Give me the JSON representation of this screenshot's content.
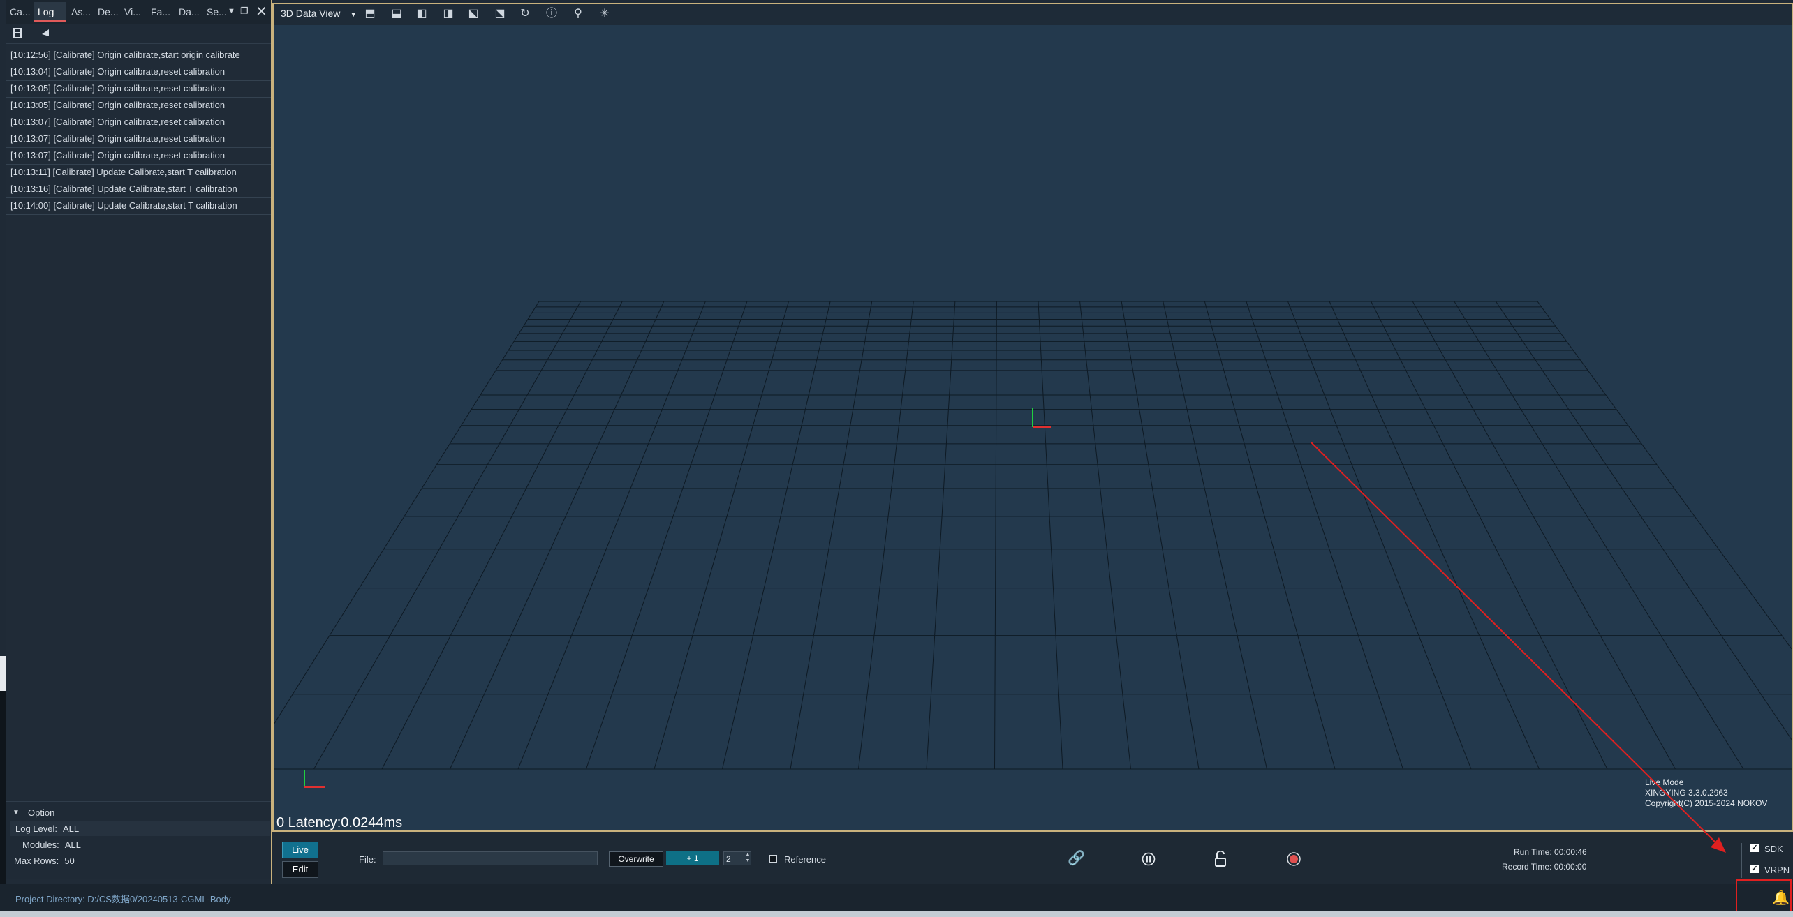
{
  "left_panel": {
    "tabs": [
      {
        "label": "Ca..."
      },
      {
        "label": "Log",
        "active": true
      },
      {
        "label": "As..."
      },
      {
        "label": "De..."
      },
      {
        "label": "Vi..."
      },
      {
        "label": "Fa..."
      },
      {
        "label": "Da..."
      },
      {
        "label": "Se..."
      }
    ],
    "log_entries": [
      "[10:12:56] [Calibrate] Origin calibrate,start origin calibrate",
      "[10:13:04] [Calibrate] Origin calibrate,reset calibration",
      "[10:13:05] [Calibrate] Origin calibrate,reset calibration",
      "[10:13:05] [Calibrate] Origin calibrate,reset calibration",
      "[10:13:07] [Calibrate] Origin calibrate,reset calibration",
      "[10:13:07] [Calibrate] Origin calibrate,reset calibration",
      "[10:13:07] [Calibrate] Origin calibrate,reset calibration",
      "[10:13:11] [Calibrate] Update Calibrate,start T calibration",
      "[10:13:16] [Calibrate] Update Calibrate,start T calibration",
      "[10:14:00] [Calibrate] Update Calibrate,start T calibration"
    ],
    "option": {
      "title": "Option",
      "log_level_label": "Log Level:",
      "log_level_value": "ALL",
      "modules_label": "Modules:",
      "modules_value": "ALL",
      "max_rows_label": "Max Rows:",
      "max_rows_value": "50"
    }
  },
  "status_bar": {
    "project_directory": "Project Directory:  D:/CS数据0/20240513-CGML-Body"
  },
  "view": {
    "title": "3D Data View",
    "latency": "0 Latency:0.0244ms",
    "mode": "Live Mode",
    "version": "XINGYING 3.3.0.2963",
    "copyright": "Copyright(C) 2015-2024 NOKOV",
    "colors": {
      "grid": "#0e1a24",
      "background": "#23394d",
      "axis_x": "#e03030",
      "axis_y": "#20d040"
    }
  },
  "controls": {
    "live_label": "Live",
    "edit_label": "Edit",
    "file_label": "File:",
    "file_value": "",
    "overwrite_label": "Overwrite",
    "increment_label": "+ 1",
    "step_value": "2",
    "reference_label": "Reference",
    "run_time": "Run Time:  00:00:46",
    "record_time": "Record Time:  00:00:00",
    "sdk_label": "SDK",
    "vrpn_label": "VRPN",
    "sdk_checked": true,
    "vrpn_checked": true
  },
  "annotation": {
    "color": "#e02020"
  }
}
